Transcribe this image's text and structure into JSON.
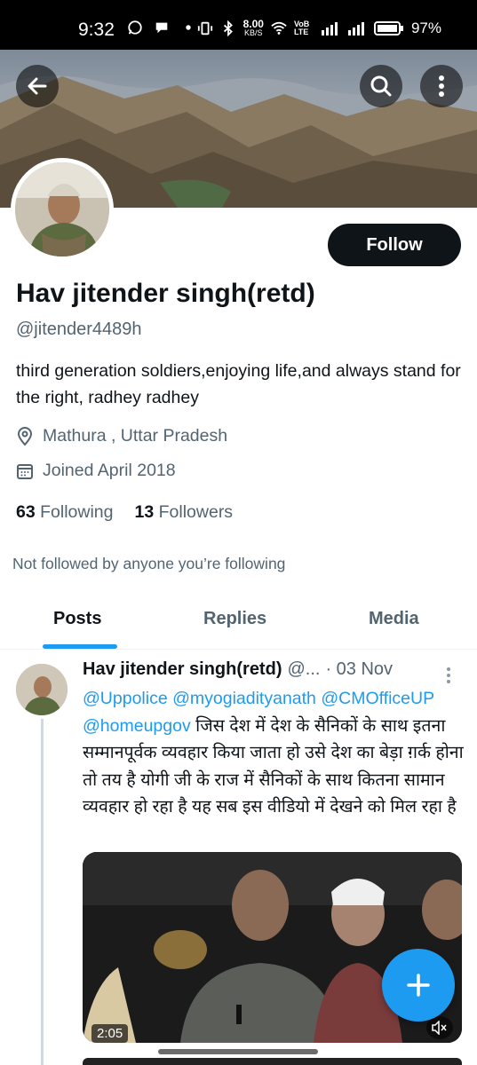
{
  "status_bar": {
    "time": "9:32",
    "net_speed": "8.00",
    "net_unit": "KB/S",
    "volte": "VoB LTE",
    "battery": "97%"
  },
  "header": {
    "back_icon": "arrow-left-icon",
    "search_icon": "search-icon",
    "more_icon": "more-vertical-icon"
  },
  "profile": {
    "display_name": "Hav jitender singh(retd)",
    "handle": "@jitender4489h",
    "follow_label": "Follow",
    "bio": "third generation soldiers,enjoying life,and always stand for the right, radhey radhey",
    "location": "Mathura , Uttar Pradesh",
    "joined": "Joined April 2018",
    "following_count": "63",
    "following_label": "Following",
    "followers_count": "13",
    "followers_label": "Followers",
    "not_followed": "Not followed by anyone you’re following"
  },
  "tabs": [
    {
      "label": "Posts",
      "active": true
    },
    {
      "label": "Replies",
      "active": false
    },
    {
      "label": "Media",
      "active": false
    }
  ],
  "post": {
    "author": "Hav jitender singh(retd)",
    "handle_trunc": "@...",
    "date": "· 03 Nov",
    "mention_1": "@Uppolice",
    "mention_2": "@myogiadityanath",
    "mention_3": "@CMOfficeUP",
    "mention_4": "@homeupgov",
    "text": "जिस देश में देश के सैनिकों के साथ इतना सम्मानपूर्वक व्यवहार किया जाता हो उसे देश का बेड़ा ग़र्क होना तो तय है योगी जी के राज में सैनिकों के साथ कितना सामान व्यवहार हो रहा है यह सब इस वीडियो में देखने को मिल रहा है",
    "video_duration": "2:05"
  },
  "colors": {
    "accent": "#1d9bf0",
    "text_primary": "#0f1419",
    "text_secondary": "#536471"
  }
}
